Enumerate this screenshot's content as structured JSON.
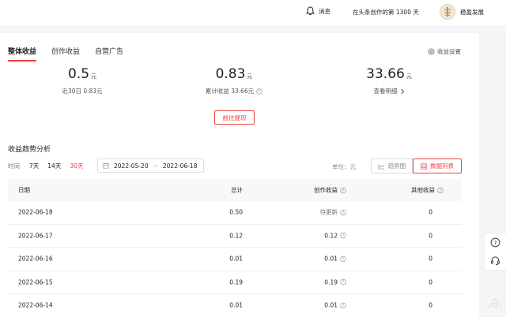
{
  "topbar": {
    "notifications_label": "消息",
    "days_text": "在头条创作的第 1300 天",
    "username": "稳盈发展"
  },
  "tabs": [
    {
      "label": "整体收益",
      "active": true
    },
    {
      "label": "创作收益",
      "active": false
    },
    {
      "label": "自营广告",
      "active": false
    }
  ],
  "settings_label": "收益设置",
  "stats": {
    "recent": {
      "value": "0.5",
      "unit": "元",
      "sub": "近30日 0.83元"
    },
    "total": {
      "value": "0.83",
      "unit": "元",
      "sub": "累计收益 33.66元"
    },
    "balance": {
      "value": "33.66",
      "unit": "元",
      "sub": "查看明细"
    }
  },
  "withdraw_label": "前往提现",
  "section_title": "收益趋势分析",
  "filters": {
    "label": "时间",
    "options": [
      {
        "label": "7天",
        "active": false
      },
      {
        "label": "14天",
        "active": false
      },
      {
        "label": "30天",
        "active": true
      }
    ],
    "date_start": "2022-05-20",
    "date_sep": "~",
    "date_end": "2022-06-18"
  },
  "unit_label": "单位：元",
  "views": {
    "trend": "趋势图",
    "list": "数据列表",
    "active": "list"
  },
  "table": {
    "headers": [
      "日期",
      "总计",
      "创作收益",
      "其他收益"
    ],
    "rows": [
      {
        "date": "2022-06-18",
        "total": "0.50",
        "creation": "待更新",
        "other": "0"
      },
      {
        "date": "2022-06-17",
        "total": "0.12",
        "creation": "0.12",
        "other": "0"
      },
      {
        "date": "2022-06-16",
        "total": "0.01",
        "creation": "0.01",
        "other": "0"
      },
      {
        "date": "2022-06-15",
        "total": "0.19",
        "creation": "0.19",
        "other": "0"
      },
      {
        "date": "2022-06-14",
        "total": "0.01",
        "creation": "0.01",
        "other": "0"
      }
    ]
  },
  "colors": {
    "accent": "#f04142",
    "muted": "#777777"
  },
  "icons": [
    "bell-icon",
    "settings-icon",
    "info-icon",
    "chevron-right-icon",
    "calendar-icon",
    "trend-chart-icon",
    "list-icon",
    "help-icon",
    "headset-icon"
  ]
}
